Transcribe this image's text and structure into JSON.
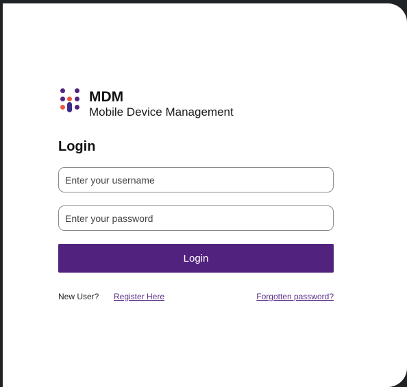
{
  "brand": {
    "title": "MDM",
    "subtitle": "Mobile Device Management",
    "logo_icon": "mdm-logo-icon",
    "colors": {
      "primary": "#52227f",
      "accent": "#e8573c",
      "secondary": "#3a2b8c"
    }
  },
  "login": {
    "heading": "Login",
    "username_placeholder": "Enter your username",
    "password_placeholder": "Enter your password",
    "button_label": "Login"
  },
  "footer": {
    "new_user_text": "New User?",
    "register_label": "Register Here",
    "forgot_label": "Forgotten password?"
  }
}
